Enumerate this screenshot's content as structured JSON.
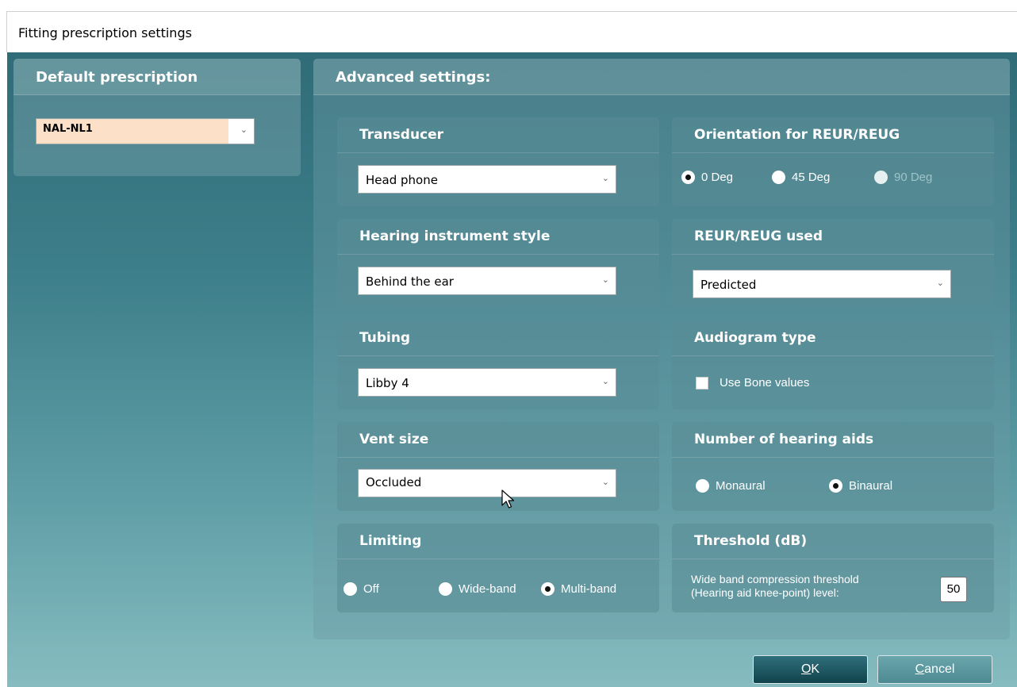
{
  "window": {
    "title": "Fitting prescription settings"
  },
  "default_prescription": {
    "title": "Default prescription",
    "selected": "NAL-NL1"
  },
  "advanced": {
    "title": "Advanced settings:",
    "transducer": {
      "title": "Transducer",
      "selected": "Head phone"
    },
    "hi_style": {
      "title": "Hearing instrument style",
      "selected": "Behind the ear"
    },
    "tubing": {
      "title": "Tubing",
      "selected": "Libby 4"
    },
    "vent": {
      "title": "Vent size",
      "selected": "Occluded"
    },
    "limiting": {
      "title": "Limiting",
      "options": [
        "Off",
        "Wide-band",
        "Multi-band"
      ],
      "selected": "Multi-band"
    },
    "orientation": {
      "title": "Orientation for REUR/REUG",
      "options": [
        "0 Deg",
        "45 Deg",
        "90 Deg"
      ],
      "selected": "0 Deg",
      "disabled": [
        "90 Deg"
      ]
    },
    "reur_used": {
      "title": "REUR/REUG used",
      "selected": "Predicted"
    },
    "audiogram": {
      "title": "Audiogram type",
      "checkbox_label": "Use Bone values",
      "checked": false
    },
    "num_aids": {
      "title": "Number of hearing aids",
      "options": [
        "Monaural",
        "Binaural"
      ],
      "selected": "Binaural"
    },
    "threshold": {
      "title": "Threshold (dB)",
      "label_line1": "Wide band compression threshold",
      "label_line2": "(Hearing aid knee-point) level:",
      "value": "50"
    }
  },
  "buttons": {
    "ok_mnemonic": "O",
    "ok_rest": "K",
    "cancel_mnemonic": "C",
    "cancel_rest": "ancel"
  },
  "colors": {
    "accent": "#3d7f8a",
    "ok_button": "#1b5660",
    "field_highlight": "#fde0c8"
  }
}
